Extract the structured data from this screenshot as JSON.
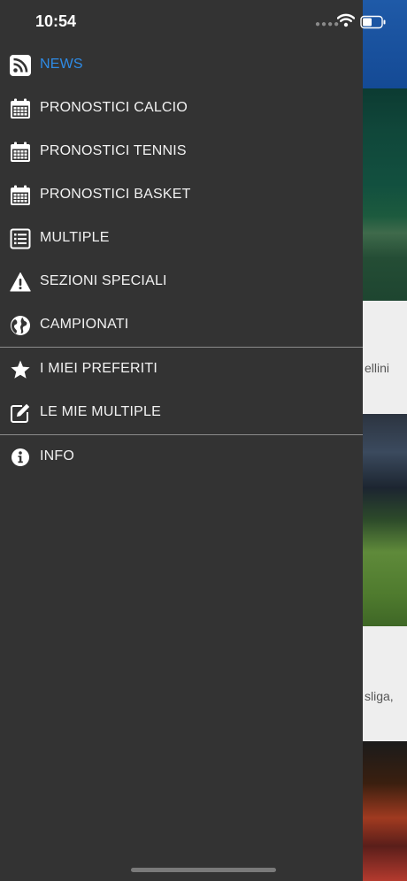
{
  "status_bar": {
    "time": "10:54"
  },
  "menu": {
    "news": "NEWS",
    "pronostici_calcio": "PRONOSTICI CALCIO",
    "pronostici_tennis": "PRONOSTICI TENNIS",
    "pronostici_basket": "PRONOSTICI BASKET",
    "multiple": "MULTIPLE",
    "sezioni_speciali": "SEZIONI SPECIALI",
    "campionati": "CAMPIONATI",
    "miei_preferiti": "I MIEI PREFERITI",
    "mie_multiple": "LE MIE MULTIPLE",
    "info": "INFO"
  },
  "background": {
    "peek_text_1": "ellini",
    "peek_text_2": "sliga,"
  },
  "colors": {
    "drawer_bg": "#333333",
    "active": "#2e8be6",
    "text": "#f2f2f2"
  },
  "icons": {
    "news": "rss-icon",
    "calcio": "calendar-icon",
    "tennis": "calendar-icon",
    "basket": "calendar-icon",
    "multiple": "list-icon",
    "sezioni": "warning-icon",
    "campionati": "globe-icon",
    "preferiti": "star-icon",
    "mie_multiple": "edit-icon",
    "info": "info-icon"
  }
}
